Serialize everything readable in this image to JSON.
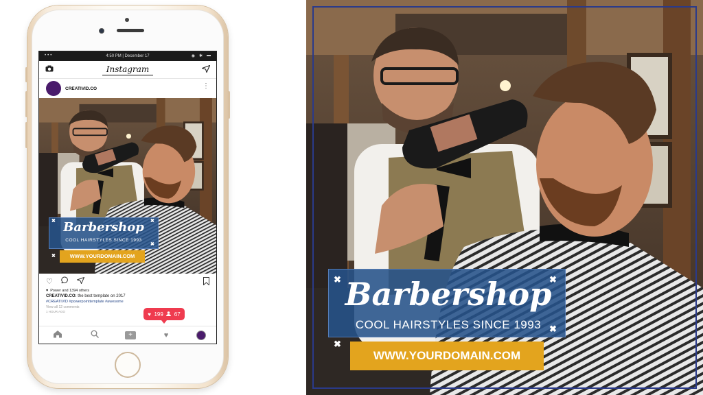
{
  "phone": {
    "status": {
      "time": "4:50 PM | December 17"
    },
    "app_title": "Instagram",
    "account": "CREATIVID.CO",
    "post": {
      "likes": "Power and 1394 others",
      "caption_user": "CREATIVID.CO:",
      "caption_text": " the best template on 2017",
      "hashtags": "#CREATIVID #powerpointtemplate #awesome",
      "view_comments": "View all 12 comments",
      "time_ago": "1 HOUR AGO"
    },
    "notification": {
      "likes": "199",
      "followers": "67"
    }
  },
  "banner": {
    "title": "Barbershop",
    "subtitle": "COOL HAIRSTYLES SINCE 1993",
    "url": "WWW.YOURDOMAIN.COM"
  },
  "icons": {
    "camera": "camera-icon",
    "send": "send-icon",
    "heart": "heart-icon",
    "comment": "comment-icon",
    "share": "share-icon",
    "bookmark": "bookmark-icon",
    "home": "home-icon",
    "search": "search-icon",
    "add": "add-icon",
    "activity": "heart-icon",
    "profile": "profile-icon",
    "close": "close-icon"
  },
  "colors": {
    "banner_blue": "#26528a",
    "banner_gold": "#e3a41e",
    "notification_red": "#ef3b4f",
    "avatar_purple": "#4a1b6b"
  }
}
